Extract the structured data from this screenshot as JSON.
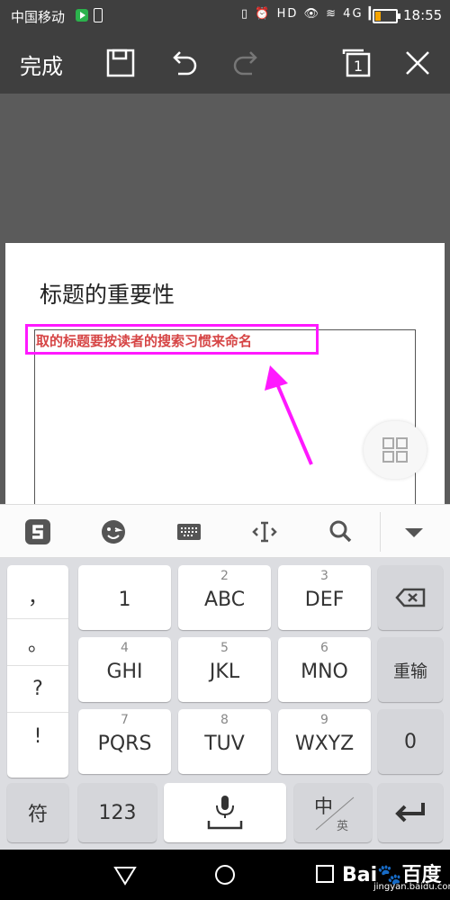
{
  "status_bar": {
    "carrier": "中国移动",
    "icons_text": "▯ ⏰ HD 👁 ≋ 4G ▎",
    "time": "18:55"
  },
  "toolbar": {
    "done_label": "完成",
    "tabs_count": "1"
  },
  "document": {
    "title": "标题的重要性",
    "subtitle": "取的标题要按读者的搜索习惯来命名"
  },
  "keyboard": {
    "punctuation": [
      "，",
      "。",
      "?",
      "!"
    ],
    "keys": [
      {
        "num": "",
        "label": "1"
      },
      {
        "num": "2",
        "label": "ABC"
      },
      {
        "num": "3",
        "label": "DEF"
      },
      {
        "num": "4",
        "label": "GHI"
      },
      {
        "num": "5",
        "label": "JKL"
      },
      {
        "num": "6",
        "label": "MNO"
      },
      {
        "num": "7",
        "label": "PQRS"
      },
      {
        "num": "8",
        "label": "TUV"
      },
      {
        "num": "9",
        "label": "WXYZ"
      }
    ],
    "reinput_label": "重输",
    "zero_label": "0",
    "symbol_label": "符",
    "numeric_label": "123",
    "lang_main": "中",
    "lang_sub": "英"
  },
  "watermark": {
    "brand": "Bai🐾百度",
    "sub": "jingyan.baidu.com"
  },
  "colors": {
    "highlight": "#ff19ff",
    "subtitle": "#d64545",
    "arrow": "#ff19ff"
  }
}
